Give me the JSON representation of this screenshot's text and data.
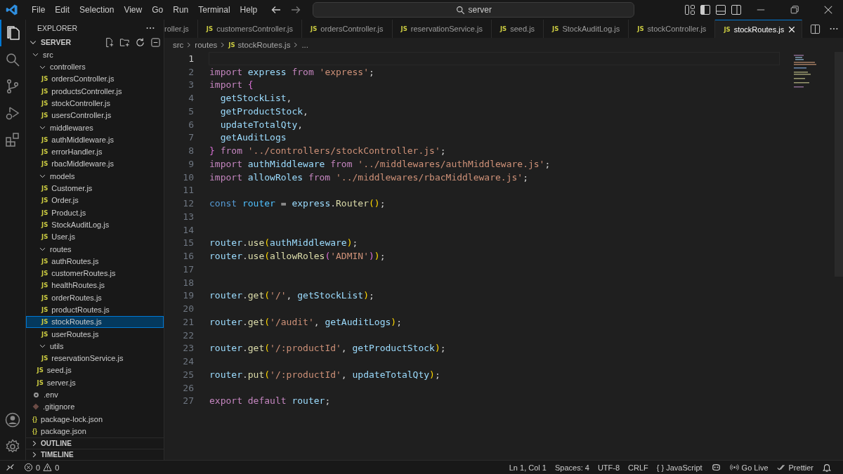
{
  "menu": [
    "File",
    "Edit",
    "Selection",
    "View",
    "Go",
    "Run",
    "Terminal",
    "Help"
  ],
  "search": {
    "value": "server"
  },
  "sidebar": {
    "title": "EXPLORER",
    "root": "SERVER",
    "tree": [
      {
        "name": "src",
        "kind": "folder",
        "expanded": true,
        "children": [
          {
            "name": "controllers",
            "kind": "folder",
            "expanded": true,
            "children": [
              {
                "badge": "JS",
                "name": "ordersController.js",
                "kind": "js",
                "selected": false
              },
              {
                "badge": "JS",
                "name": "productsController.js",
                "kind": "js",
                "selected": false
              },
              {
                "badge": "JS",
                "name": "stockController.js",
                "kind": "js",
                "selected": false
              },
              {
                "badge": "JS",
                "name": "usersController.js",
                "kind": "js",
                "selected": false
              }
            ]
          },
          {
            "name": "middlewares",
            "kind": "folder",
            "expanded": true,
            "children": [
              {
                "badge": "JS",
                "name": "authMiddleware.js",
                "kind": "js",
                "selected": false
              },
              {
                "badge": "JS",
                "name": "errorHandler.js",
                "kind": "js",
                "selected": false
              },
              {
                "badge": "JS",
                "name": "rbacMiddleware.js",
                "kind": "js",
                "selected": false
              }
            ]
          },
          {
            "name": "models",
            "kind": "folder",
            "expanded": true,
            "children": [
              {
                "badge": "JS",
                "name": "Customer.js",
                "kind": "js",
                "selected": false
              },
              {
                "badge": "JS",
                "name": "Order.js",
                "kind": "js",
                "selected": false
              },
              {
                "badge": "JS",
                "name": "Product.js",
                "kind": "js",
                "selected": false
              },
              {
                "badge": "JS",
                "name": "StockAuditLog.js",
                "kind": "js",
                "selected": false
              },
              {
                "badge": "JS",
                "name": "User.js",
                "kind": "js",
                "selected": false
              }
            ]
          },
          {
            "name": "routes",
            "kind": "folder",
            "expanded": true,
            "children": [
              {
                "badge": "JS",
                "name": "authRoutes.js",
                "kind": "js",
                "selected": false
              },
              {
                "badge": "JS",
                "name": "customerRoutes.js",
                "kind": "js",
                "selected": false
              },
              {
                "badge": "JS",
                "name": "healthRoutes.js",
                "kind": "js",
                "selected": false
              },
              {
                "badge": "JS",
                "name": "orderRoutes.js",
                "kind": "js",
                "selected": false
              },
              {
                "badge": "JS",
                "name": "productRoutes.js",
                "kind": "js",
                "selected": false
              },
              {
                "badge": "JS",
                "name": "stockRoutes.js",
                "kind": "js",
                "selected": true
              },
              {
                "badge": "JS",
                "name": "userRoutes.js",
                "kind": "js",
                "selected": false
              }
            ]
          },
          {
            "name": "utils",
            "kind": "folder",
            "expanded": true,
            "children": [
              {
                "badge": "JS",
                "name": "reservationService.js",
                "kind": "js",
                "selected": false
              }
            ]
          },
          {
            "badge": "JS",
            "name": "seed.js",
            "kind": "js",
            "selected": false
          },
          {
            "badge": "JS",
            "name": "server.js",
            "kind": "js",
            "selected": false
          }
        ]
      },
      {
        "name": ".env",
        "kind": "env",
        "selected": false
      },
      {
        "name": ".gitignore",
        "kind": "git",
        "selected": false
      },
      {
        "badge": "{}",
        "name": "package-lock.json",
        "kind": "json",
        "selected": false
      },
      {
        "badge": "{}",
        "name": "package.json",
        "kind": "json",
        "selected": false
      }
    ],
    "sections": [
      "OUTLINE",
      "TIMELINE"
    ]
  },
  "tabs": [
    {
      "label": "roller.js",
      "selected": false
    },
    {
      "badge": "JS",
      "label": "customersController.js",
      "selected": false
    },
    {
      "badge": "JS",
      "label": "ordersController.js",
      "selected": false
    },
    {
      "badge": "JS",
      "label": "reservationService.js",
      "selected": false
    },
    {
      "badge": "JS",
      "label": "seed.js",
      "selected": false
    },
    {
      "badge": "JS",
      "label": "StockAuditLog.js",
      "selected": false
    },
    {
      "badge": "JS",
      "label": "stockController.js",
      "selected": false
    },
    {
      "badge": "JS",
      "label": "stockRoutes.js",
      "selected": true
    }
  ],
  "breadcrumb": [
    {
      "text": "src"
    },
    {
      "text": "routes"
    },
    {
      "badge": "JS",
      "text": "stockRoutes.js"
    },
    {
      "text": "..."
    }
  ],
  "code": [
    {
      "number": "1",
      "current": true
    },
    {
      "number": "2",
      "current": false,
      "tokens": [
        {
          "kind": "kw",
          "text": "import "
        },
        {
          "kind": "var",
          "text": "express "
        },
        {
          "kind": "kw",
          "text": "from "
        },
        {
          "kind": "str",
          "text": "'express'"
        },
        {
          "kind": "punct",
          "text": ";"
        }
      ]
    },
    {
      "number": "3",
      "current": false,
      "tokens": [
        {
          "kind": "kw",
          "text": "import "
        },
        {
          "kind": "brace",
          "text": "{"
        }
      ]
    },
    {
      "number": "4",
      "current": false,
      "tokens": [
        {
          "kind": "var",
          "text": "  getStockList"
        },
        {
          "kind": "punct",
          "text": ","
        }
      ]
    },
    {
      "number": "5",
      "current": false,
      "tokens": [
        {
          "kind": "var",
          "text": "  getProductStock"
        },
        {
          "kind": "punct",
          "text": ","
        }
      ]
    },
    {
      "number": "6",
      "current": false,
      "tokens": [
        {
          "kind": "var",
          "text": "  updateTotalQty"
        },
        {
          "kind": "punct",
          "text": ","
        }
      ]
    },
    {
      "number": "7",
      "current": false,
      "tokens": [
        {
          "kind": "var",
          "text": "  getAuditLogs"
        }
      ]
    },
    {
      "number": "8",
      "current": false,
      "tokens": [
        {
          "kind": "brace",
          "text": "}"
        },
        {
          "kind": "kw",
          "text": " from "
        },
        {
          "kind": "str",
          "text": "'../controllers/stockController.js'"
        },
        {
          "kind": "punct",
          "text": ";"
        }
      ]
    },
    {
      "number": "9",
      "current": false,
      "tokens": [
        {
          "kind": "kw",
          "text": "import "
        },
        {
          "kind": "var",
          "text": "authMiddleware "
        },
        {
          "kind": "kw",
          "text": "from "
        },
        {
          "kind": "str",
          "text": "'../middlewares/authMiddleware.js'"
        },
        {
          "kind": "punct",
          "text": ";"
        }
      ]
    },
    {
      "number": "10",
      "current": false,
      "tokens": [
        {
          "kind": "kw",
          "text": "import "
        },
        {
          "kind": "var",
          "text": "allowRoles "
        },
        {
          "kind": "kw",
          "text": "from "
        },
        {
          "kind": "str",
          "text": "'../middlewares/rbacMiddleware.js'"
        },
        {
          "kind": "punct",
          "text": ";"
        }
      ]
    },
    {
      "number": "11",
      "current": false
    },
    {
      "number": "12",
      "current": false,
      "tokens": [
        {
          "kind": "decl",
          "text": "const "
        },
        {
          "kind": "const",
          "text": "router"
        },
        {
          "kind": "punct",
          "text": " = "
        },
        {
          "kind": "var",
          "text": "express"
        },
        {
          "kind": "punct",
          "text": "."
        },
        {
          "kind": "fn",
          "text": "Router"
        },
        {
          "kind": "paren",
          "text": "()"
        },
        {
          "kind": "punct",
          "text": ";"
        }
      ]
    },
    {
      "number": "13",
      "current": false
    },
    {
      "number": "14",
      "current": false
    },
    {
      "number": "15",
      "current": false,
      "tokens": [
        {
          "kind": "var",
          "text": "router"
        },
        {
          "kind": "punct",
          "text": "."
        },
        {
          "kind": "fn",
          "text": "use"
        },
        {
          "kind": "paren",
          "text": "("
        },
        {
          "kind": "var",
          "text": "authMiddleware"
        },
        {
          "kind": "paren",
          "text": ")"
        },
        {
          "kind": "punct",
          "text": ";"
        }
      ]
    },
    {
      "number": "16",
      "current": false,
      "tokens": [
        {
          "kind": "var",
          "text": "router"
        },
        {
          "kind": "punct",
          "text": "."
        },
        {
          "kind": "fn",
          "text": "use"
        },
        {
          "kind": "paren",
          "text": "("
        },
        {
          "kind": "fn",
          "text": "allowRoles"
        },
        {
          "kind": "paren2",
          "text": "("
        },
        {
          "kind": "str",
          "text": "'ADMIN'"
        },
        {
          "kind": "paren2",
          "text": ")"
        },
        {
          "kind": "paren",
          "text": ")"
        },
        {
          "kind": "punct",
          "text": ";"
        }
      ]
    },
    {
      "number": "17",
      "current": false
    },
    {
      "number": "18",
      "current": false
    },
    {
      "number": "19",
      "current": false,
      "tokens": [
        {
          "kind": "var",
          "text": "router"
        },
        {
          "kind": "punct",
          "text": "."
        },
        {
          "kind": "fn",
          "text": "get"
        },
        {
          "kind": "paren",
          "text": "("
        },
        {
          "kind": "str",
          "text": "'/'"
        },
        {
          "kind": "punct",
          "text": ", "
        },
        {
          "kind": "var",
          "text": "getStockList"
        },
        {
          "kind": "paren",
          "text": ")"
        },
        {
          "kind": "punct",
          "text": ";"
        }
      ]
    },
    {
      "number": "20",
      "current": false
    },
    {
      "number": "21",
      "current": false,
      "tokens": [
        {
          "kind": "var",
          "text": "router"
        },
        {
          "kind": "punct",
          "text": "."
        },
        {
          "kind": "fn",
          "text": "get"
        },
        {
          "kind": "paren",
          "text": "("
        },
        {
          "kind": "str",
          "text": "'/audit'"
        },
        {
          "kind": "punct",
          "text": ", "
        },
        {
          "kind": "var",
          "text": "getAuditLogs"
        },
        {
          "kind": "paren",
          "text": ")"
        },
        {
          "kind": "punct",
          "text": ";"
        }
      ]
    },
    {
      "number": "22",
      "current": false
    },
    {
      "number": "23",
      "current": false,
      "tokens": [
        {
          "kind": "var",
          "text": "router"
        },
        {
          "kind": "punct",
          "text": "."
        },
        {
          "kind": "fn",
          "text": "get"
        },
        {
          "kind": "paren",
          "text": "("
        },
        {
          "kind": "str",
          "text": "'/:productId'"
        },
        {
          "kind": "punct",
          "text": ", "
        },
        {
          "kind": "var",
          "text": "getProductStock"
        },
        {
          "kind": "paren",
          "text": ")"
        },
        {
          "kind": "punct",
          "text": ";"
        }
      ]
    },
    {
      "number": "24",
      "current": false
    },
    {
      "number": "25",
      "current": false,
      "tokens": [
        {
          "kind": "var",
          "text": "router"
        },
        {
          "kind": "punct",
          "text": "."
        },
        {
          "kind": "fn",
          "text": "put"
        },
        {
          "kind": "paren",
          "text": "("
        },
        {
          "kind": "str",
          "text": "'/:productId'"
        },
        {
          "kind": "punct",
          "text": ", "
        },
        {
          "kind": "var",
          "text": "updateTotalQty"
        },
        {
          "kind": "paren",
          "text": ")"
        },
        {
          "kind": "punct",
          "text": ";"
        }
      ]
    },
    {
      "number": "26",
      "current": false
    },
    {
      "number": "27",
      "current": false,
      "tokens": [
        {
          "kind": "kw",
          "text": "export default "
        },
        {
          "kind": "var",
          "text": "router"
        },
        {
          "kind": "punct",
          "text": ";"
        }
      ]
    }
  ],
  "status_bar": {
    "errors": "0",
    "warnings": "0",
    "position": "Ln 1, Col 1",
    "indent": "Spaces: 4",
    "encoding": "UTF-8",
    "eol": "CRLF",
    "language": "{ } JavaScript",
    "live": "Go Live",
    "formatter": "Prettier"
  }
}
